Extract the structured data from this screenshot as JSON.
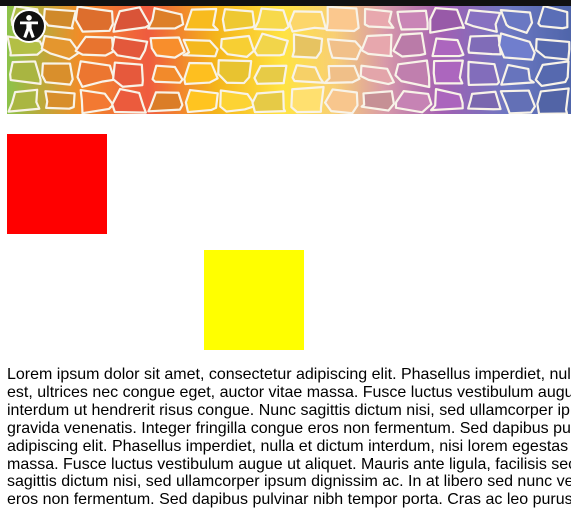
{
  "colors": {
    "page_background": "#ffffff",
    "top_strip": "#111111",
    "accessibility_button_background": "#111111",
    "accessibility_button_icon": "#ffffff",
    "red_box": "#ff0000",
    "yellow_box": "#ffff00",
    "text": "#000000",
    "mosaic_palette": [
      "#8bc34a",
      "#f28c28",
      "#ef5b3f",
      "#f4b41a",
      "#ffe342",
      "#f8cf74",
      "#d89aa9",
      "#a35fb2",
      "#6c78c2",
      "#4f65aa"
    ]
  },
  "banner": {
    "decorative_style": "colorful stained-glass mosaic"
  },
  "accessibility": {
    "icon": "accessibility-person-icon"
  },
  "boxes": {
    "red": {
      "color": "#ff0000"
    },
    "yellow": {
      "color": "#ffff00"
    }
  },
  "body_text": {
    "lines": [
      "Lorem ipsum dolor sit amet, consectetur adipiscing elit. Phasellus imperdiet, nul",
      "est, ultrices nec congue eget, auctor vitae massa. Fusce luctus vestibulum augu",
      "interdum ut hendrerit risus congue. Nunc sagittis dictum nisi, sed ullamcorper ip",
      "gravida venenatis. Integer fringilla congue eros non fermentum. Sed dapibus pu",
      "adipiscing elit. Phasellus imperdiet, nulla et dictum interdum, nisi lorem egestas",
      "massa. Fusce luctus vestibulum augue ut aliquet. Mauris ante ligula, facilisis sec",
      "sagittis dictum nisi, sed ullamcorper ipsum dignissim ac. In at libero sed nunc ve",
      "eros non fermentum. Sed dapibus pulvinar nibh tempor porta. Cras ac leo purus"
    ]
  }
}
